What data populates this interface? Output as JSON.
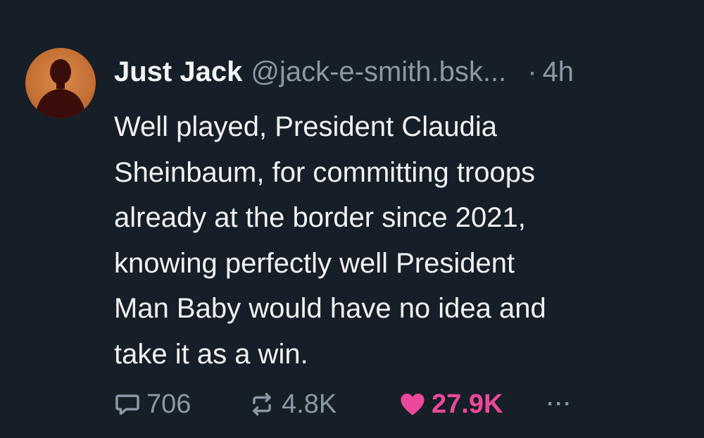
{
  "post": {
    "author": {
      "display_name": "Just Jack",
      "handle": "@jack-e-smith.bsk...",
      "avatar_icon": "person-silhouette-icon"
    },
    "separator": "·",
    "timestamp": "4h",
    "text": "Well played, President Claudia\nSheinbaum, for committing troops\nalready at the border since 2021,\nknowing perfectly well President\nMan Baby would have no idea and\ntake it as a win.",
    "actions": {
      "reply": {
        "icon": "reply-icon",
        "count": "706"
      },
      "repost": {
        "icon": "repost-icon",
        "count": "4.8K"
      },
      "like": {
        "icon": "heart-icon",
        "count": "27.9K",
        "color": "#ec4899",
        "liked": true
      },
      "more": {
        "icon": "more-options-icon",
        "label": "···"
      }
    }
  },
  "theme": {
    "background": "#161e27",
    "text": "#f1f3f5",
    "muted": "#8b98a5"
  }
}
